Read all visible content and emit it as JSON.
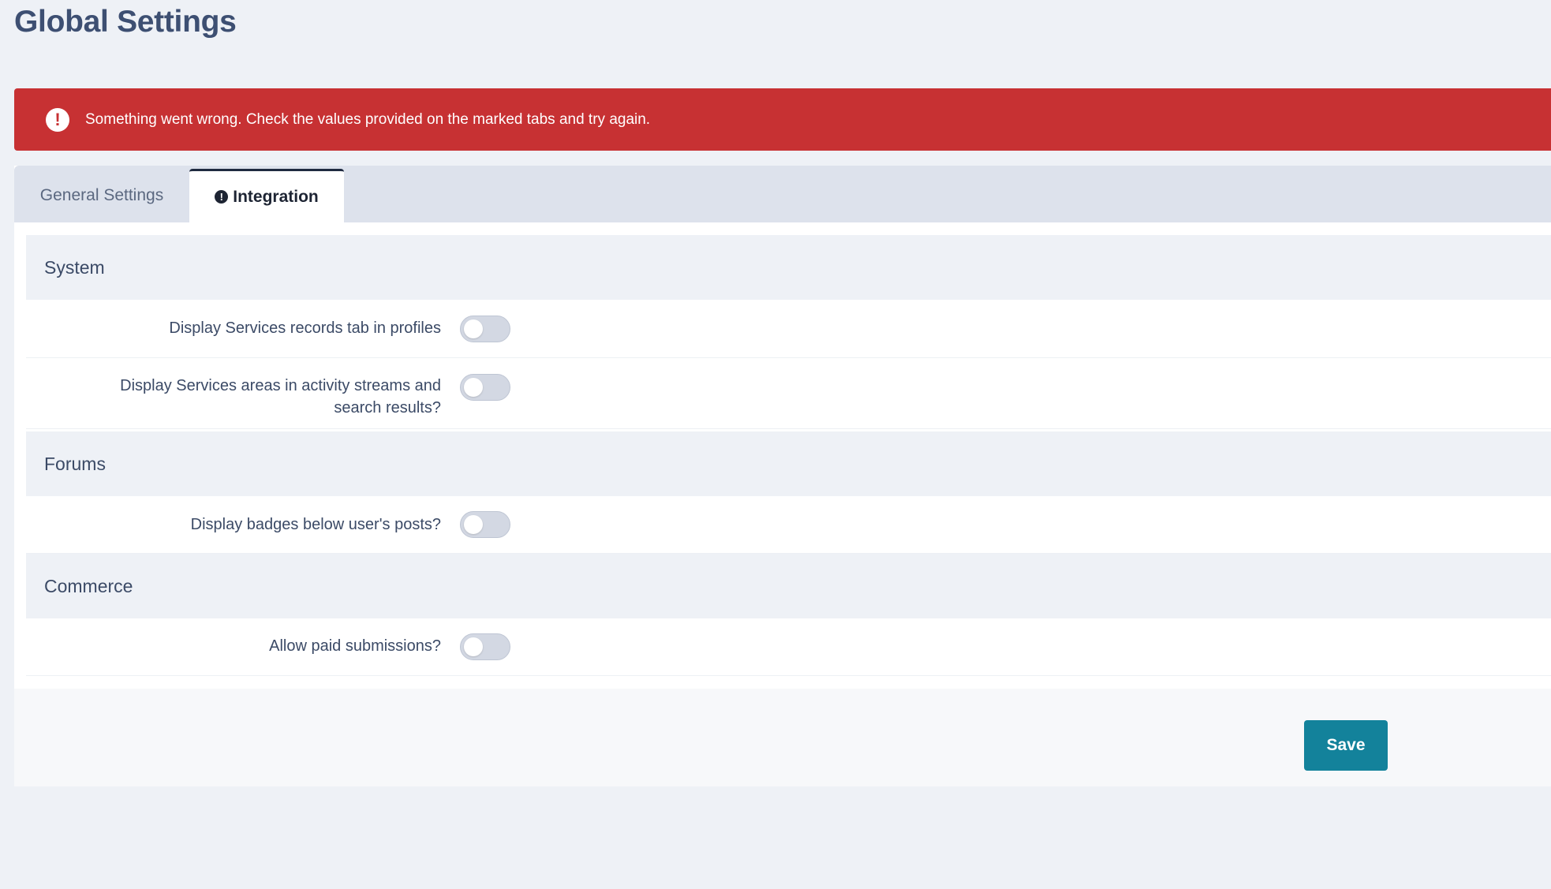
{
  "page": {
    "title": "Global Settings"
  },
  "error": {
    "icon": "exclamation-circle-icon",
    "message": "Something went wrong. Check the values provided on the marked tabs and try again.",
    "color": "#c73133"
  },
  "tabs": {
    "general": {
      "label": "General Settings"
    },
    "integration": {
      "label": "Integration",
      "icon": "exclamation-circle-icon",
      "active": true
    }
  },
  "sections": {
    "system": {
      "title": "System",
      "settings": [
        {
          "label": "Display Services records tab in profiles",
          "enabled": false
        },
        {
          "label_line1": "Display Services areas in activity streams and",
          "label_line2": "search results?",
          "enabled": false
        }
      ]
    },
    "forums": {
      "title": "Forums",
      "settings": [
        {
          "label": "Display badges below user's posts?",
          "enabled": false
        }
      ]
    },
    "commerce": {
      "title": "Commerce",
      "settings": [
        {
          "label": "Allow paid submissions?",
          "enabled": false
        }
      ]
    }
  },
  "footer": {
    "save_label": "Save",
    "save_color": "#13829b"
  }
}
